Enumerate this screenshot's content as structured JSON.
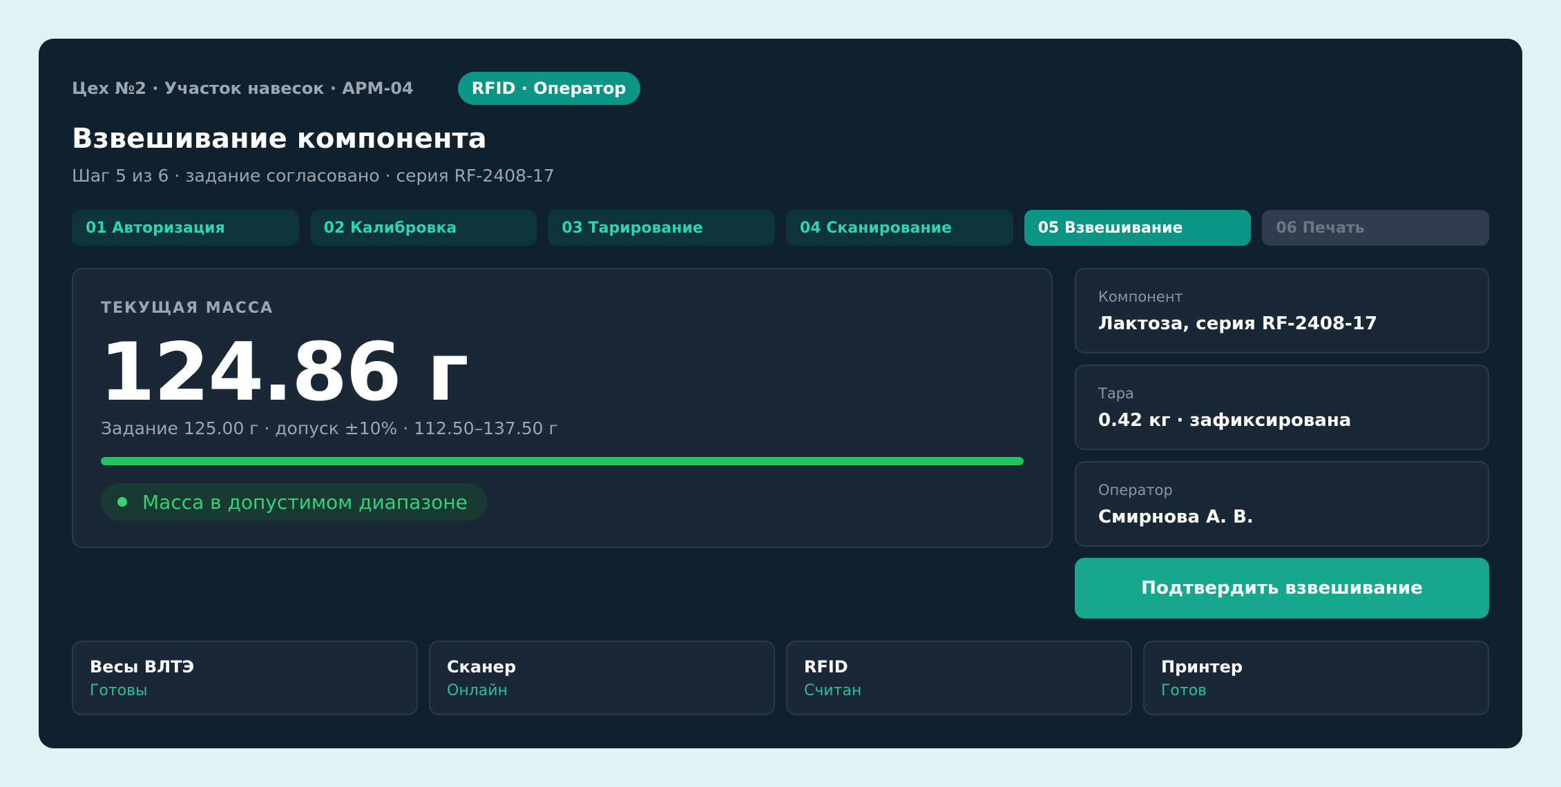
{
  "header": {
    "breadcrumb": "Цех №2 · Участок навесок · АРМ-04",
    "badge": "RFID · Оператор",
    "title": "Взвешивание компонента",
    "subtitle": "Шаг 5 из 6 · задание согласовано · серия RF-2408-17"
  },
  "steps": [
    {
      "label": "01 Авторизация",
      "state": "done"
    },
    {
      "label": "02 Калибровка",
      "state": "done"
    },
    {
      "label": "03 Тарирование",
      "state": "done"
    },
    {
      "label": "04 Сканирование",
      "state": "done"
    },
    {
      "label": "05 Взвешивание",
      "state": "active"
    },
    {
      "label": "06 Печать",
      "state": "pending"
    }
  ],
  "mass": {
    "label": "ТЕКУЩАЯ МАССА",
    "value": "124.86 г",
    "task": "Задание 125.00 г · допуск ±10% · 112.50–137.50 г",
    "progress_percent": 100,
    "status": "Масса в допустимом диапазоне"
  },
  "info": {
    "component": {
      "label": "Компонент",
      "value": "Лактоза, серия RF-2408-17"
    },
    "tare": {
      "label": "Тара",
      "value": "0.42 кг · зафиксирована"
    },
    "operator": {
      "label": "Оператор",
      "value": "Смирнова А. В."
    }
  },
  "actions": {
    "confirm_label": "Подтвердить взвешивание"
  },
  "devices": [
    {
      "name": "Весы ВЛТЭ",
      "status": "Готовы"
    },
    {
      "name": "Сканер",
      "status": "Онлайн"
    },
    {
      "name": "RFID",
      "status": "Считан"
    },
    {
      "name": "Принтер",
      "status": "Готов"
    }
  ],
  "colors": {
    "accent": "#0c9484",
    "success": "#35d27a",
    "panel": "#10202d"
  }
}
